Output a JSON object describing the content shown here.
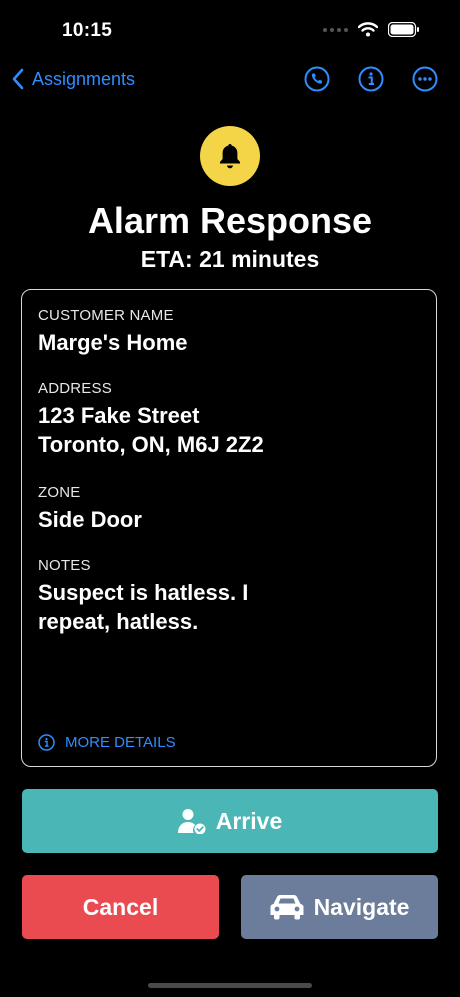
{
  "status_bar": {
    "time": "10:15"
  },
  "nav": {
    "back_label": "Assignments",
    "actions": [
      "phone-icon",
      "info-icon",
      "more-icon"
    ]
  },
  "header": {
    "icon": "bell-icon",
    "icon_color": "#f4d548",
    "title": "Alarm Response",
    "eta": "ETA: 21 minutes"
  },
  "details": {
    "customer_name_label": "CUSTOMER NAME",
    "customer_name": "Marge's Home",
    "address_label": "ADDRESS",
    "address_line1": "123 Fake Street",
    "address_line2": "Toronto, ON, M6J 2Z2",
    "zone_label": "ZONE",
    "zone": "Side Door",
    "notes_label": "NOTES",
    "notes_line1": "Suspect is hatless. I",
    "notes_line2": "repeat, hatless.",
    "more_details": "MORE DETAILS"
  },
  "actions": {
    "arrive": "Arrive",
    "cancel": "Cancel",
    "navigate": "Navigate"
  },
  "colors": {
    "accent": "#2f8dff",
    "arrive": "#4ab6b5",
    "cancel": "#ea4b51",
    "navigate": "#6c7d9b"
  }
}
